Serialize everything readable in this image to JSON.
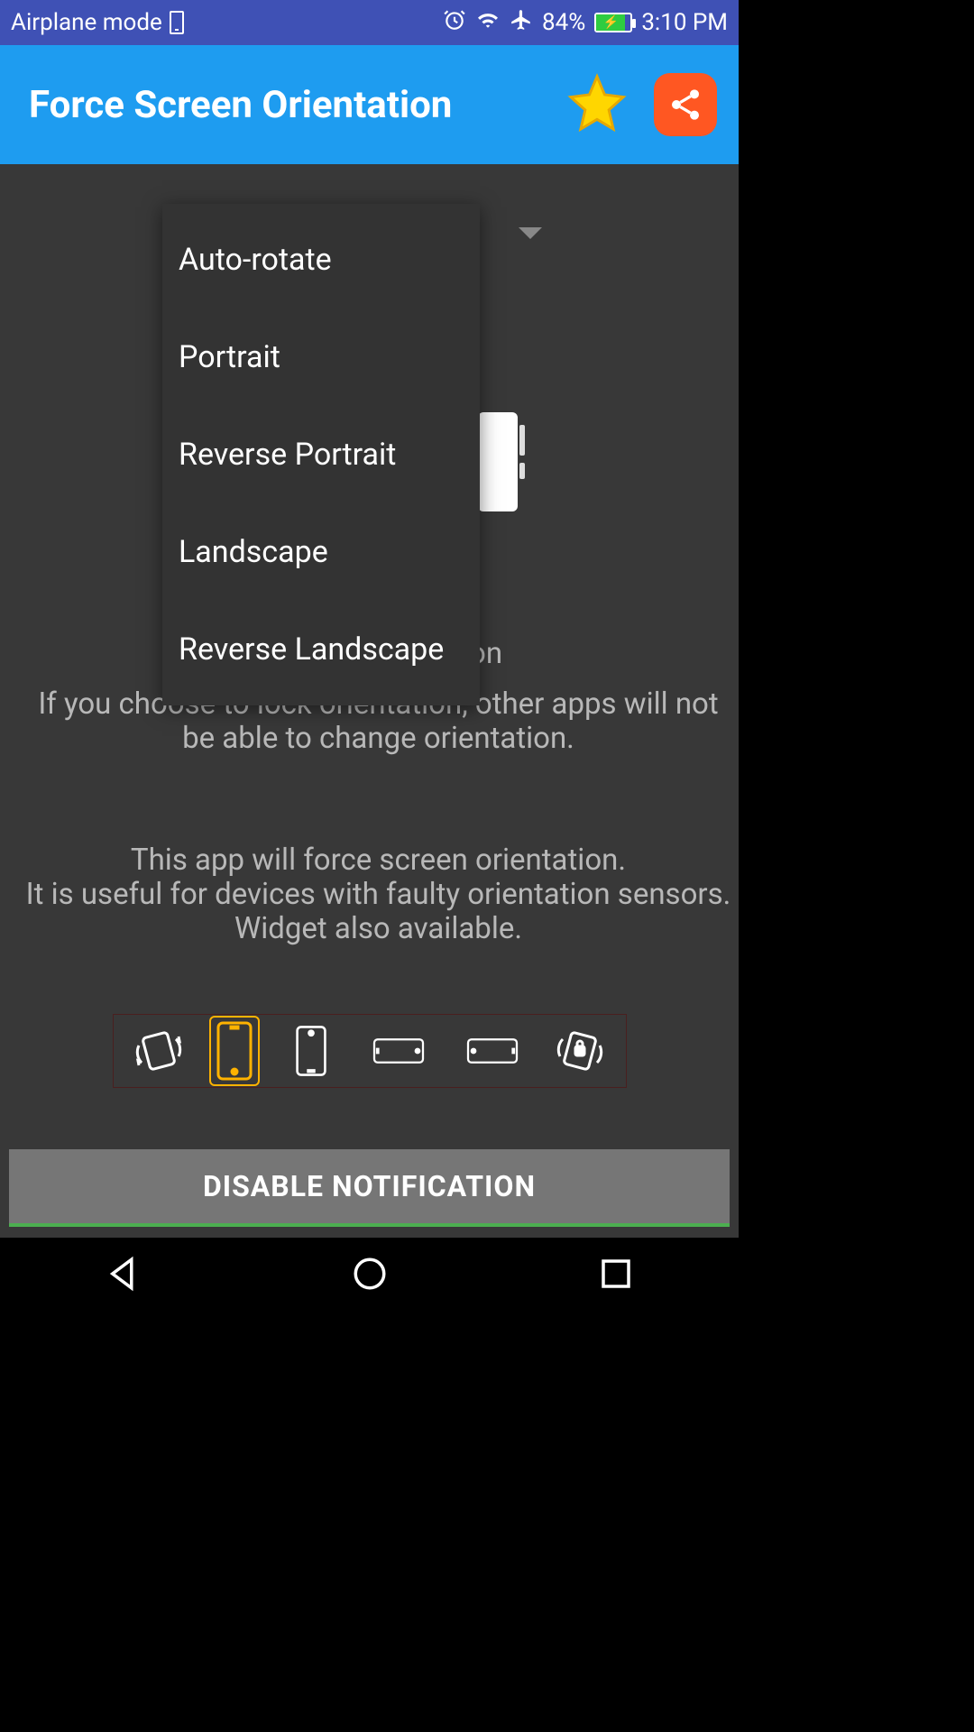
{
  "status": {
    "airplane_label": "Airplane mode",
    "battery_percent": "84%",
    "time": "3:10 PM"
  },
  "app": {
    "title": "Force Screen Orientation"
  },
  "dropdown": {
    "items": [
      "Auto-rotate",
      "Portrait",
      "Reverse Portrait",
      "Landscape",
      "Reverse Landscape"
    ]
  },
  "body": {
    "lock_suffix": "on",
    "lock_text": "If you choose to lock orientation, other apps will not be able to change orientation.",
    "description": "This app will force screen orientation.\nIt is useful for devices with faulty orientation sensors. Widget also available."
  },
  "button": {
    "disable": "DISABLE NOTIFICATION"
  }
}
